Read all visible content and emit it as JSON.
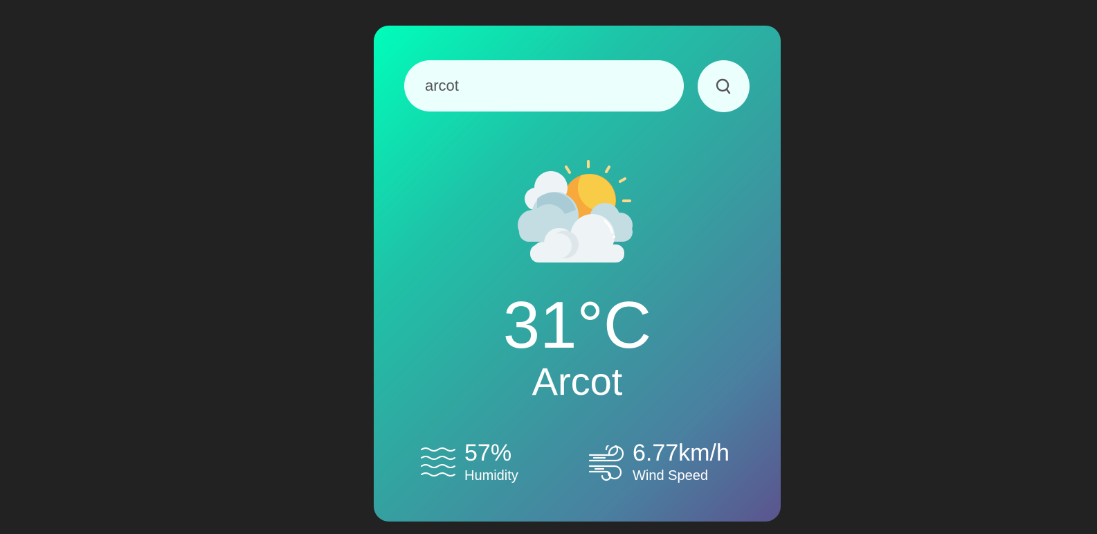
{
  "search": {
    "value": "arcot",
    "icon": "search-icon"
  },
  "weather": {
    "icon": "partly-cloudy-sun-icon",
    "temperature": "31°C",
    "city": "Arcot"
  },
  "details": {
    "humidity": {
      "value": "57%",
      "label": "Humidity",
      "icon": "humidity-waves-icon"
    },
    "wind": {
      "value": "6.77km/h",
      "label": "Wind Speed",
      "icon": "wind-icon"
    }
  },
  "colors": {
    "background": "#222222",
    "gradient_start": "#00feba",
    "gradient_end": "#5b548e",
    "input_background": "#ebfffc",
    "text": "#ffffff"
  }
}
